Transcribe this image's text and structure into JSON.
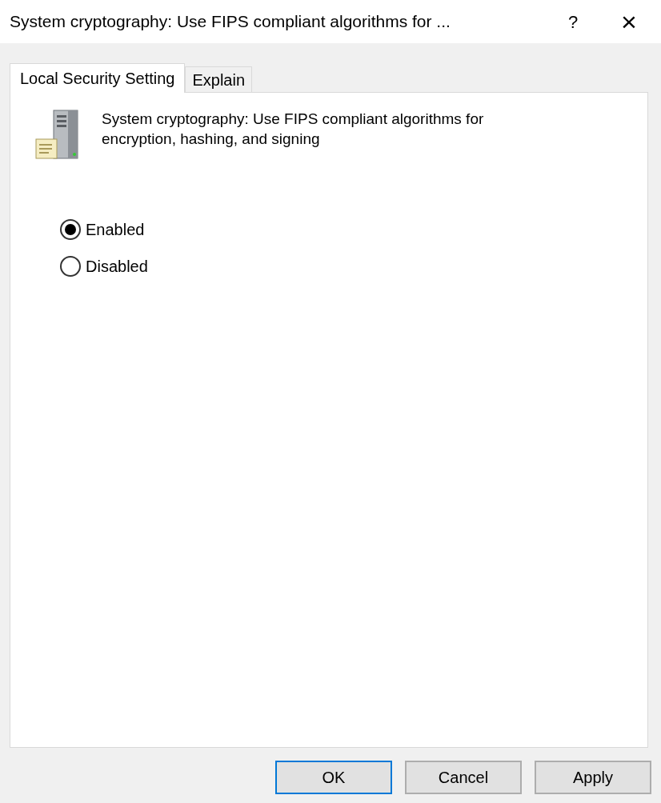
{
  "window": {
    "title": "System cryptography: Use FIPS compliant algorithms for ...",
    "help": "?",
    "close": "×"
  },
  "tabs": [
    {
      "label": "Local Security Setting",
      "selected": true
    },
    {
      "label": "Explain",
      "selected": false
    }
  ],
  "policy": {
    "description": "System cryptography: Use FIPS compliant algorithms for encryption, hashing, and signing"
  },
  "options": [
    {
      "label": "Enabled",
      "selected": true
    },
    {
      "label": "Disabled",
      "selected": false
    }
  ],
  "buttons": [
    {
      "label": "OK",
      "default": true
    },
    {
      "label": "Cancel",
      "default": false
    },
    {
      "label": "Apply",
      "default": false
    }
  ]
}
